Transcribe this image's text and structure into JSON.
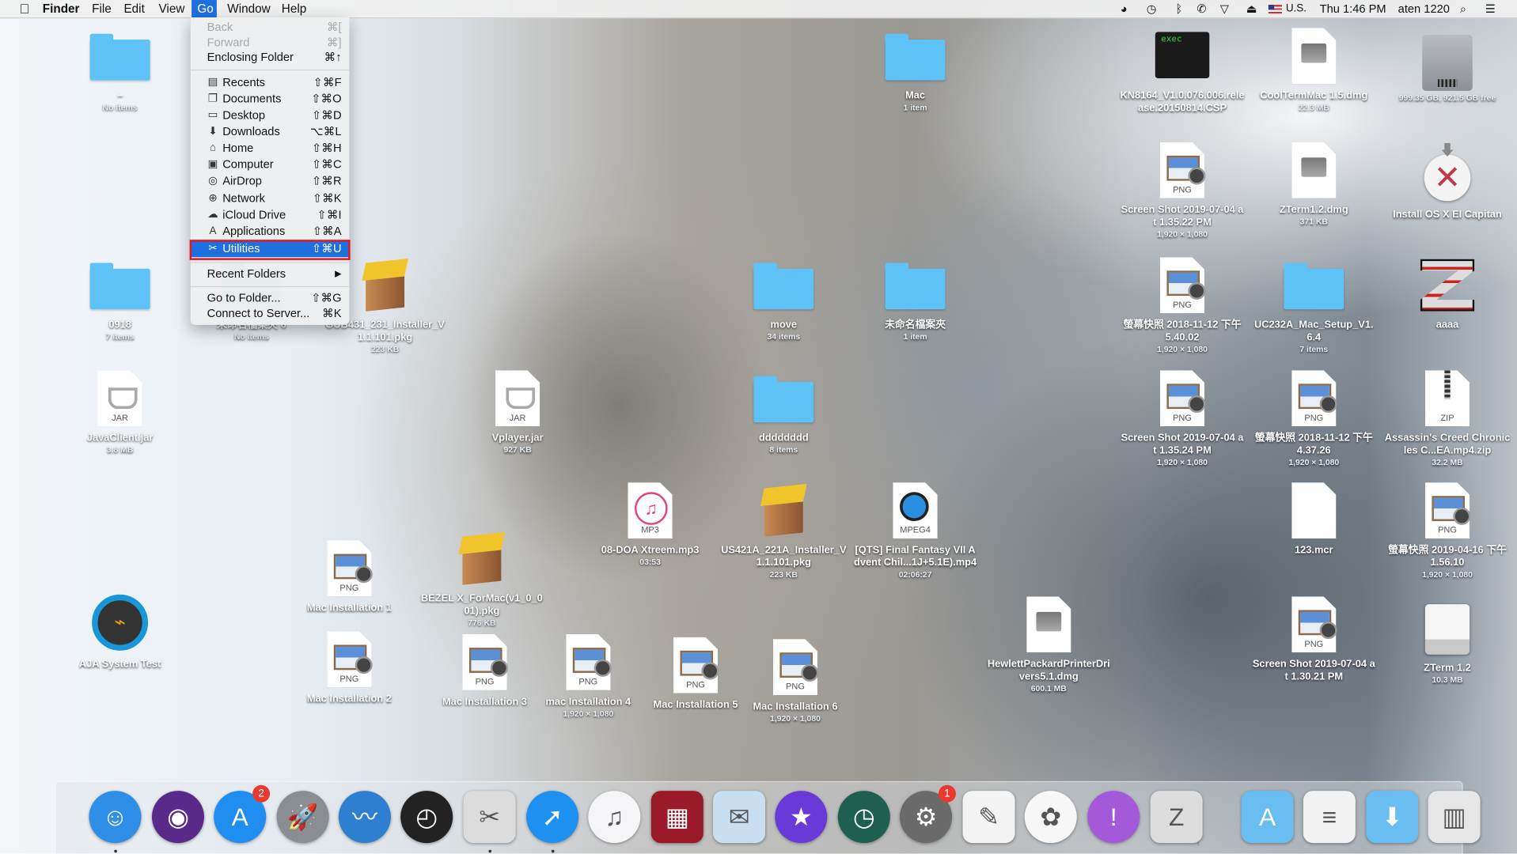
{
  "menubar": {
    "apple": "",
    "app_name": "Finder",
    "menus": [
      "File",
      "Edit",
      "View",
      "Go",
      "Window",
      "Help"
    ],
    "status": {
      "input_source": "U.S.",
      "clock": "Thu 1:46 PM",
      "user": "aten 1220"
    }
  },
  "go_menu": {
    "items": [
      {
        "label": "Back",
        "shortcut": "⌘[",
        "enabled": false
      },
      {
        "label": "Forward",
        "shortcut": "⌘]",
        "enabled": false
      },
      {
        "label": "Enclosing Folder",
        "shortcut": "⌘↑",
        "enabled": true
      },
      {
        "label": "Recents",
        "shortcut": "⇧⌘F",
        "icon": "recents-icon"
      },
      {
        "label": "Documents",
        "shortcut": "⇧⌘O",
        "icon": "documents-icon"
      },
      {
        "label": "Desktop",
        "shortcut": "⇧⌘D",
        "icon": "desktop-icon"
      },
      {
        "label": "Downloads",
        "shortcut": "⌥⌘L",
        "icon": "downloads-icon"
      },
      {
        "label": "Home",
        "shortcut": "⇧⌘H",
        "icon": "home-icon"
      },
      {
        "label": "Computer",
        "shortcut": "⇧⌘C",
        "icon": "computer-icon"
      },
      {
        "label": "AirDrop",
        "shortcut": "⇧⌘R",
        "icon": "airdrop-icon"
      },
      {
        "label": "Network",
        "shortcut": "⇧⌘K",
        "icon": "network-icon"
      },
      {
        "label": "iCloud Drive",
        "shortcut": "⇧⌘I",
        "icon": "icloud-icon"
      },
      {
        "label": "Applications",
        "shortcut": "⇧⌘A",
        "icon": "applications-icon"
      },
      {
        "label": "Utilities",
        "shortcut": "⇧⌘U",
        "icon": "utilities-icon",
        "highlighted": true
      },
      {
        "label": "Recent Folders",
        "shortcut": "▶"
      },
      {
        "label": "Go to Folder...",
        "shortcut": "⇧⌘G"
      },
      {
        "label": "Connect to Server...",
        "shortcut": "⌘K"
      }
    ]
  },
  "desktop": {
    "icons": [
      {
        "icon": "folder",
        "name": "–",
        "info": "No items"
      },
      {
        "icon": "folder",
        "name": "Mac",
        "info": "1 item"
      },
      {
        "icon": "exec",
        "badge": "exec",
        "name": "KN8164_V1.0.076.006.release.20150814.CSP",
        "info": ""
      },
      {
        "icon": "dmg",
        "name": "CoolTermMac 1.5.dmg",
        "info": "22.3 MB"
      },
      {
        "icon": "hdd",
        "name": "",
        "info": "999.35 GB, 921.5 GB free"
      },
      {
        "icon": "png",
        "badge": "PNG",
        "name": "Screen Shot 2019-07-04 at 1.35.22 PM",
        "info": "1,920 × 1,080"
      },
      {
        "icon": "dmg",
        "name": "ZTerm1.2.dmg",
        "info": "371 KB"
      },
      {
        "icon": "installer",
        "name": "Install OS X El Capitan",
        "info": ""
      },
      {
        "icon": "folder",
        "name": "0918",
        "info": "7 items"
      },
      {
        "icon": "folder",
        "name": "未命名檔案夾 6",
        "info": "No items"
      },
      {
        "icon": "pkg",
        "name": "GUB431_231_Installer_V1.1.101.pkg",
        "info": "223 KB"
      },
      {
        "icon": "folder",
        "name": "move",
        "info": "34 items"
      },
      {
        "icon": "folder",
        "name": "未命名檔案夾",
        "info": "1 item"
      },
      {
        "icon": "png",
        "badge": "PNG",
        "name": "螢幕快照 2018-11-12 下午 5.40.02",
        "info": "1,920 × 1,080"
      },
      {
        "icon": "folder",
        "name": "UC232A_Mac_Setup_V1.6.4",
        "info": "7 items"
      },
      {
        "icon": "zterm",
        "name": "aaaa",
        "info": ""
      },
      {
        "icon": "jar",
        "badge": "JAR",
        "name": "JavaClient.jar",
        "info": "3.8 MB"
      },
      {
        "icon": "jar",
        "badge": "JAR",
        "name": "Vplayer.jar",
        "info": "927 KB"
      },
      {
        "icon": "folder",
        "name": "dddddddd",
        "info": "8 items"
      },
      {
        "icon": "png",
        "badge": "PNG",
        "name": "Screen Shot 2019-07-04 at 1.35.24 PM",
        "info": "1,920 × 1,080"
      },
      {
        "icon": "png",
        "badge": "PNG",
        "name": "螢幕快照 2018-11-12 下午 4.37.26",
        "info": "1,920 × 1,080"
      },
      {
        "icon": "zip",
        "badge": "ZIP",
        "name": "Assassin's Creed Chronicles C...EA.mp4.zip",
        "info": "32.2 MB"
      },
      {
        "icon": "mp3",
        "badge": "MP3",
        "name": "08-DOA Xtreem.mp3",
        "info": "03:53"
      },
      {
        "icon": "pkg",
        "name": "US421A_221A_Installer_V1.1.101.pkg",
        "info": "223 KB"
      },
      {
        "icon": "mp4",
        "badge": "MPEG4",
        "name": "[QTS] Final Fantasy VII Advent Chil...1J+5.1E).mp4",
        "info": "02:06:27"
      },
      {
        "icon": "blank",
        "name": "123.mcr",
        "info": ""
      },
      {
        "icon": "png",
        "badge": "PNG",
        "name": "螢幕快照 2019-04-16 下午 1.56.10",
        "info": "1,920 × 1,080"
      },
      {
        "icon": "png",
        "badge": "PNG",
        "name": "Mac Installation 1",
        "info": ""
      },
      {
        "icon": "pkg",
        "name": "BEZEL X_ForMac(v1_0_001).pkg",
        "info": "776 KB"
      },
      {
        "icon": "aja",
        "name": "AJA System Test",
        "info": ""
      },
      {
        "icon": "dmg",
        "name": "HewlettPackardPrinterDrivers5.1.dmg",
        "info": "600.1 MB"
      },
      {
        "icon": "png",
        "badge": "PNG",
        "name": "Screen Shot 2019-07-04 at 1.30.21 PM",
        "info": ""
      },
      {
        "icon": "drive",
        "name": "ZTerm 1.2",
        "info": "10.3 MB"
      },
      {
        "icon": "png",
        "badge": "PNG",
        "name": "Mac Installation 2",
        "info": ""
      },
      {
        "icon": "png",
        "badge": "PNG",
        "name": "Mac Installation 3",
        "info": ""
      },
      {
        "icon": "png",
        "badge": "PNG",
        "name": "mac Installation 4",
        "info": "1,920 × 1,080"
      },
      {
        "icon": "png",
        "badge": "PNG",
        "name": "Mac Installation 5",
        "info": ""
      },
      {
        "icon": "png",
        "badge": "PNG",
        "name": "Mac Installation 6",
        "info": "1,920 × 1,080"
      }
    ]
  },
  "dock": {
    "items": [
      {
        "icon": "finder-icon",
        "color": "#2f8fe8",
        "running": true
      },
      {
        "icon": "siri-icon",
        "color": "#5a2a8a"
      },
      {
        "icon": "app-store-icon",
        "color": "#1f8ef0",
        "badge": "2"
      },
      {
        "icon": "launchpad-icon",
        "color": "#8a8d92"
      },
      {
        "icon": "openoffice-icon",
        "color": "#2f7fd0"
      },
      {
        "icon": "dashboard-icon",
        "color": "#222222"
      },
      {
        "icon": "grab-scissors-icon",
        "color": "#dcdcdc",
        "running": true
      },
      {
        "icon": "safari-icon",
        "color": "#1e90f0",
        "running": true
      },
      {
        "icon": "itunes-icon",
        "color": "#f5f5f7"
      },
      {
        "icon": "photo-booth-icon",
        "color": "#9a1a2a"
      },
      {
        "icon": "mail-icon",
        "color": "#c8dff2"
      },
      {
        "icon": "imovie-icon",
        "color": "#6a3ad8"
      },
      {
        "icon": "time-machine-icon",
        "color": "#1f5f4f"
      },
      {
        "icon": "system-preferences-icon",
        "color": "#6a6a6a",
        "badge": "1"
      },
      {
        "icon": "textedit-icon",
        "color": "#f4f4f4"
      },
      {
        "icon": "photos-icon",
        "color": "#f7f7f7"
      },
      {
        "icon": "feedback-assistant-icon",
        "color": "#a45ad8"
      },
      {
        "icon": "zterm-icon",
        "color": "#dddddd"
      },
      {
        "icon": "applications-folder-icon",
        "color": "#69bdf0"
      },
      {
        "icon": "documents-stack-icon",
        "color": "#f2f2f2"
      },
      {
        "icon": "downloads-folder-icon",
        "color": "#69bdf0"
      },
      {
        "icon": "trash-icon",
        "color": "#e6e6e6"
      }
    ]
  }
}
